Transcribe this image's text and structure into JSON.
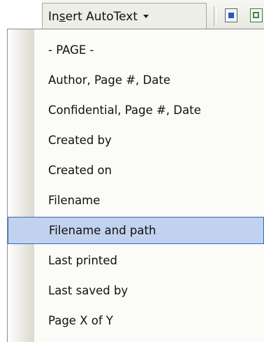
{
  "toolbar": {
    "autotext_pre": "In",
    "autotext_u": "s",
    "autotext_post": "ert AutoText",
    "dropdown_icon": "chevron-down-icon",
    "icons": [
      "insert-page-number-icon",
      "insert-number-of-pages-icon"
    ]
  },
  "menu": {
    "selected_index": 6,
    "items": [
      {
        "label": "- PAGE -"
      },
      {
        "label": "Author, Page #, Date"
      },
      {
        "label": "Confidential, Page #, Date"
      },
      {
        "label": "Created by"
      },
      {
        "label": "Created on"
      },
      {
        "label": "Filename"
      },
      {
        "label": "Filename and path"
      },
      {
        "label": "Last printed"
      },
      {
        "label": "Last saved by"
      },
      {
        "label": "Page X of Y"
      }
    ]
  },
  "colors": {
    "highlight": "#c1d2ee",
    "highlight_border": "#316ac5"
  }
}
